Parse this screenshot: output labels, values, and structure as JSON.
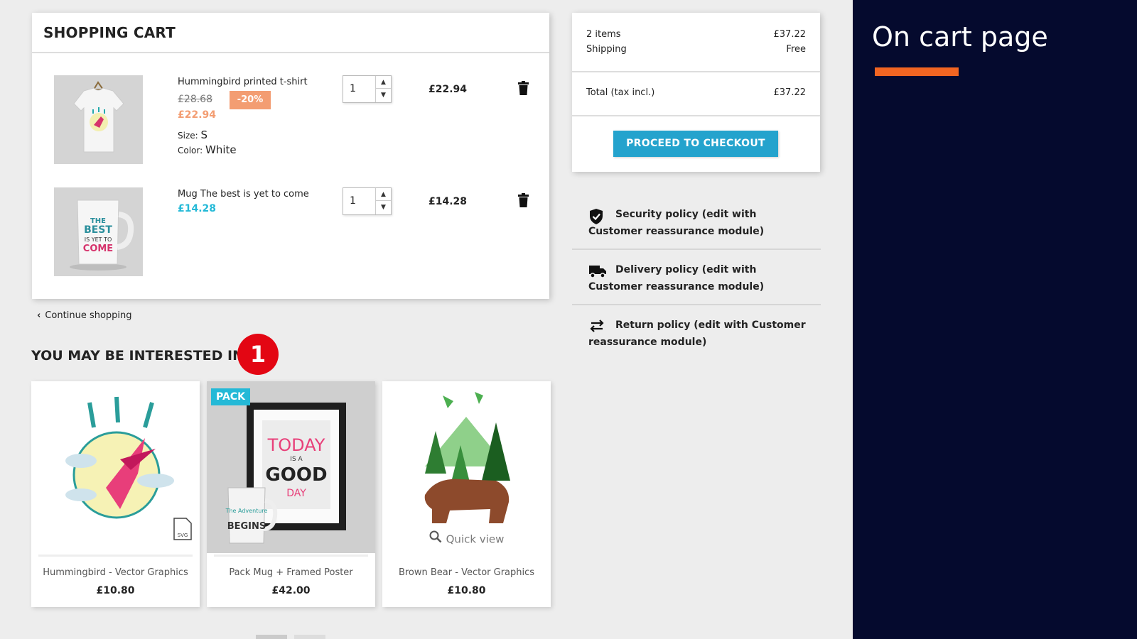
{
  "cart": {
    "title": "SHOPPING CART",
    "items": [
      {
        "name": "Hummingbird printed t-shirt",
        "old_price": "£28.68",
        "discount": "-20%",
        "price": "£22.94",
        "size_label": "Size:",
        "size_value": "S",
        "color_label": "Color:",
        "color_value": "White",
        "quantity": "1",
        "line_total": "£22.94"
      },
      {
        "name": "Mug The best is yet to come",
        "price": "£14.28",
        "quantity": "1",
        "line_total": "£14.28"
      }
    ],
    "continue_label": "Continue shopping"
  },
  "interest": {
    "title": "YOU MAY BE INTERESTED IN",
    "step_badge": "1",
    "products": [
      {
        "name": "Hummingbird - Vector Graphics",
        "price": "£10.80"
      },
      {
        "name": "Pack Mug + Framed Poster",
        "price": "£42.00",
        "tag": "PACK"
      },
      {
        "name": "Brown Bear - Vector Graphics",
        "price": "£10.80",
        "quick_view": "Quick view"
      }
    ]
  },
  "summary": {
    "items_label": "2 items",
    "items_value": "£37.22",
    "shipping_label": "Shipping",
    "shipping_value": "Free",
    "total_label": "Total (tax incl.)",
    "total_value": "£37.22",
    "checkout_label": "PROCEED TO CHECKOUT"
  },
  "reassurance": [
    {
      "icon": "shield-icon",
      "text": "Security policy (edit with Customer reassurance module)"
    },
    {
      "icon": "truck-icon",
      "text": "Delivery policy (edit with Customer reassurance module)"
    },
    {
      "icon": "arrows-icon",
      "text": "Return policy (edit with Customer reassurance module)"
    }
  ],
  "side_panel": {
    "title": "On cart page"
  },
  "colors": {
    "accent": "#24b9d7",
    "discount": "#f39d72",
    "badge": "#e30613",
    "panel": "#050a2e",
    "underline": "#f26522"
  }
}
